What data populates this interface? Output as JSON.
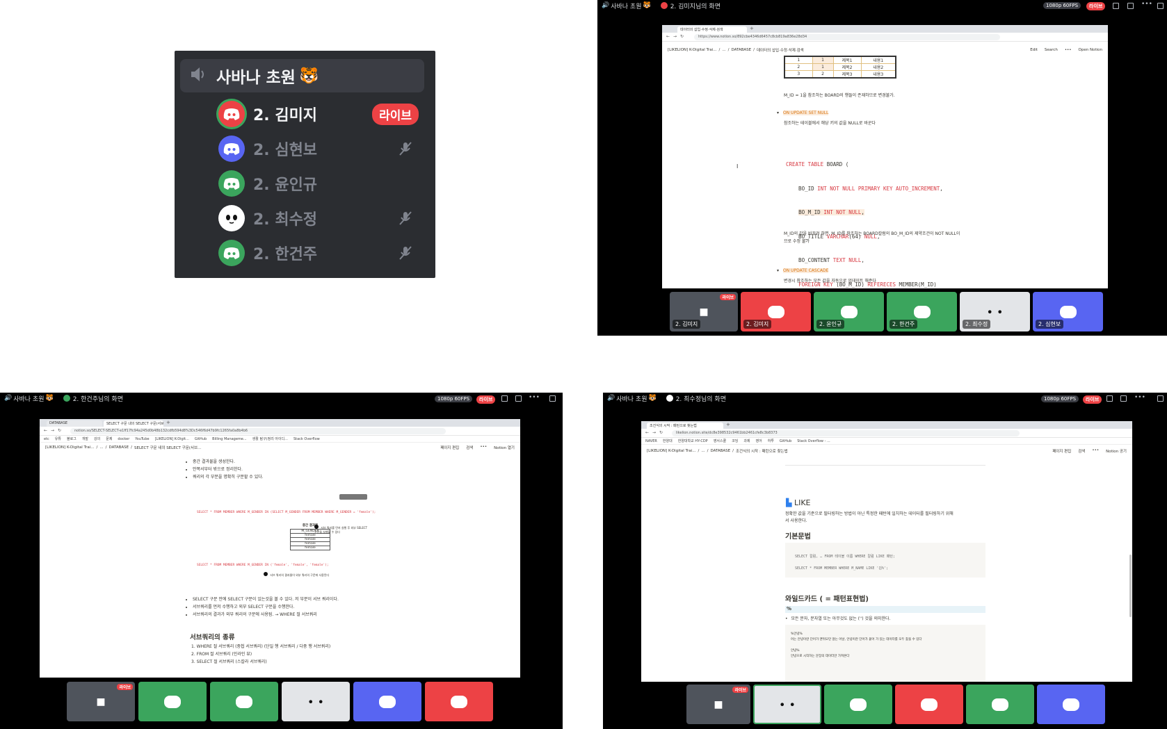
{
  "voice": {
    "channel": "사바나 초원",
    "members": [
      {
        "name": "2. 김미지",
        "live": "라이브",
        "color": "#ed4245"
      },
      {
        "name": "2. 심현보",
        "color": "#5865f2"
      },
      {
        "name": "2. 윤인규",
        "color": "#3ba55d"
      },
      {
        "name": "2. 최수정",
        "color": "#ffffff"
      },
      {
        "name": "2. 한건주",
        "color": "#3ba55d"
      }
    ]
  },
  "q2": {
    "channel": "사바나 초원",
    "stream_title": "2. 김미지님의 화면",
    "quality": "1080p 60FPS",
    "live": "라이브",
    "tab": "데이터의 삽입·수정·삭제·검색",
    "url": "https://www.notion.so/892cbe4346d6457c8cb819a836e28d34",
    "breadcrumb": [
      "[LIKELION] K-Digital Trai...",
      "/",
      "...",
      "/",
      "DATABASE",
      "/",
      "데이터의 삽입·수정·삭제·검색"
    ],
    "actions": [
      "Edit",
      "Search",
      "•••",
      "Open Notion"
    ],
    "table": [
      [
        "1",
        "1",
        "제목1",
        "내용1"
      ],
      [
        "2",
        "1",
        "제목2",
        "내용2"
      ],
      [
        "3",
        "2",
        "제목3",
        "내용3"
      ]
    ],
    "note1": "M_ID = 1을 참조하는 BOARD의 행들이 존재하므로 변경불가.",
    "toggle1": "ON UPDATE SET NULL",
    "desc1": "참조하는 테이블에서 해당 키의 값을 NULL로 바꾼다",
    "code": [
      "CREATE TABLE BOARD (",
      "    BO_ID INT NOT NULL PRIMARY KEY AUTO_INCREMENT,",
      "    BO_M_ID INT NOT NULL,",
      "    BO_TITLE VARCHAR(64) NULL,",
      "    BO_CONTENT TEXT NULL,",
      "    FOREIGN KEY (BO_M_ID) REFERECES MEMBER(M_ID)",
      ");"
    ],
    "note2a": "M_ID의 값을 바꾸려 하면, M_ID를 참조하는 BOARD칼럼의 BO_M_ID의 제약조건이 NOT NULL이",
    "note2b": "므로 수정 불가",
    "toggle2": "ON UPDATE CASCADE",
    "desc2": "변경시 참조하는 모든 값을 자동으로 업데이트 해준다",
    "tiles": [
      "2. 김미지",
      "2. 김미지",
      "2. 윤인규",
      "2. 한건주",
      "2. 최수정",
      "2. 심현보"
    ]
  },
  "q3": {
    "channel": "사바나 초원",
    "stream_title": "2. 한건주님의 화면",
    "quality": "1080p 60FPS",
    "live": "라이브",
    "tabs": [
      "DATABASE",
      "SELECT 구문 내의 SELECT 구문(서브..."
    ],
    "url": "notion.so/SELECT-SELECT-e1ff17fc94a245d0b48b132cdfb594d8%3Dc546f6d47b9fc1265fa0a8b4b6",
    "bookmarks": [
      "etc",
      "유튜",
      "블로그",
      "개발",
      "강의",
      "문제",
      "docker",
      "YouTube",
      "[LIKELION] K-Digit...",
      "GitHub",
      "Billing Manageme...",
      "생활 탐구(정리 아이디...",
      "Stack Overflow"
    ],
    "breadcrumb": [
      "[LIKELION] K-Digital Trai...",
      "/",
      "...",
      "/",
      "DATABASE",
      "/",
      "SELECT 구문 내의 SELECT 구문(서브..."
    ],
    "actions": [
      "페이지 편집",
      "검색",
      "•••",
      "Notion 열기"
    ],
    "bullets_top": [
      "중간 결과물을 생성한다.",
      "안쪽서부터 밖으로 정리한다.",
      "쿼리의 각 부분을 명확히 구분할 수 있다."
    ],
    "sql1": "SELECT * FROM MEMBER WHERE M_GENDER IN (SELECT M_GENDER FROM MEMBER WHERE M_GENDER = 'female');",
    "mid_title": "중간 결과물",
    "mid_col": "M_GENDER",
    "mid_vals": [
      "female",
      "female",
      "female",
      "female"
    ],
    "ann1": "서브 쿼리를 먼저 실행 후 외부 SELECT 구문을 실행할 수 있다",
    "sql2": "SELECT * FROM MEMBER WHERE M_GENDER IN ('female', 'female', 'female');",
    "ann2": "서브 쿼리의 결과물이 외부 쿼리의 구문에 사용된다",
    "bullets": [
      "SELECT 구문 안에 SELECT 구문이 있는것을 볼 수 있다. 저 부분이 서브 쿼리이다.",
      "서브쿼리를 먼저 수행하고 외부 SELECT 구문을 수행한다.",
      "서브쿼리의 결과가 외부 쿼리의 구문에 사용됨. → WHERE 절 서브쿼리"
    ],
    "heading": "서브쿼리의 종류",
    "list": [
      "1. WHERE 절 서브쿼리 (중첩 서브쿼리) (단일 행 서브쿼리 / 다중 행 서브쿼리)",
      "2. FROM 절 서브쿼리 (인라인 뷰)",
      "3. SELECT 절 서브쿼리 (스칼라 서브쿼리)"
    ]
  },
  "q4": {
    "channel": "사바나 초원",
    "stream_title": "2. 최수정님의 화면",
    "quality": "1080p 60FPS",
    "live": "라이브",
    "tab": "조건식의 시작 : 패턴으로 찾는법",
    "url": "likelion.notion.site/dc8e398532c9461bb2461cfe8c3b8373",
    "bookmarks": [
      "NAVER",
      "한양대",
      "한양대학교 HY-CDP",
      "영서스쿨",
      "코딩",
      "과제",
      "영어",
      "하투",
      "GitHub",
      "Stack Overflow - ..."
    ],
    "breadcrumb": [
      "[LIKELION] K-Digital Trai...",
      "/",
      "...",
      "/",
      "DATABASE",
      "/",
      "조건식의 시작 : 패턴으로 찾는법"
    ],
    "actions": [
      "페이지 편집",
      "검색",
      "•••",
      "Notion 공기"
    ],
    "like_title": "LIKE",
    "like_desc1": "정확한 값을 기준으로 필터링하는 방법이 아닌 특정한 패턴에 일치하는 데이터를 필터링하기 위해",
    "like_desc2": "서 사용한다.",
    "h_basic": "기본문법",
    "code1": "SELECT 칼럼, … FROM 테이블 이름 WHERE 칼럼 LIKE 패턴;",
    "code2": "SELECT * FROM MEMBER WHERE M_NAME LIKE '김%';",
    "h_wild": "와일드카드 ( = 패턴표현법)",
    "pct": "%",
    "wild_bullet": "모든 문자, 문자열 또는 아무것도 없는 ('') 것을 의미한다.",
    "ex1": "%안녕%",
    "ex1d": "어는 안녕이란 단어가 맨뒤모던 않는 어날, 안녕이란 단어가 붙어 가 있는 데이터를 모두 찾을 수 있다",
    "ex2": "안녕%",
    "ex2d": "안녕으로 시작하는 문장의 데이터만 가져온다"
  }
}
